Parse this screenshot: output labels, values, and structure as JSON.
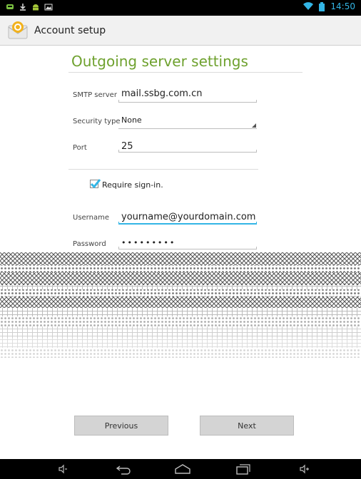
{
  "status_bar": {
    "clock": "14:50",
    "left_icons": [
      "chat-icon",
      "download-icon",
      "android-icon",
      "image-icon"
    ],
    "right_icons": [
      "wifi-icon",
      "battery-icon"
    ]
  },
  "action_bar": {
    "title": "Account setup",
    "app_icon": "email-account-icon"
  },
  "form": {
    "heading": "Outgoing server settings",
    "smtp_label": "SMTP server",
    "smtp_value": "mail.ssbg.com.cn",
    "security_label": "Security type",
    "security_value": "None",
    "port_label": "Port",
    "port_value": "25",
    "require_signin_label": "Require sign-in.",
    "require_signin_checked": true,
    "username_label": "Username",
    "username_value": "yourname@yourdomain.com",
    "password_label": "Password",
    "password_value": "•••••••••"
  },
  "buttons": {
    "previous": "Previous",
    "next": "Next"
  },
  "nav_bar": {
    "icons": [
      "volume-down-icon",
      "back-icon",
      "home-icon",
      "recent-apps-icon",
      "volume-up-icon"
    ]
  },
  "colors": {
    "accent": "#33b5e5",
    "heading": "#6ea12e",
    "status_bar": "#000000",
    "button": "#d4d4d4"
  }
}
